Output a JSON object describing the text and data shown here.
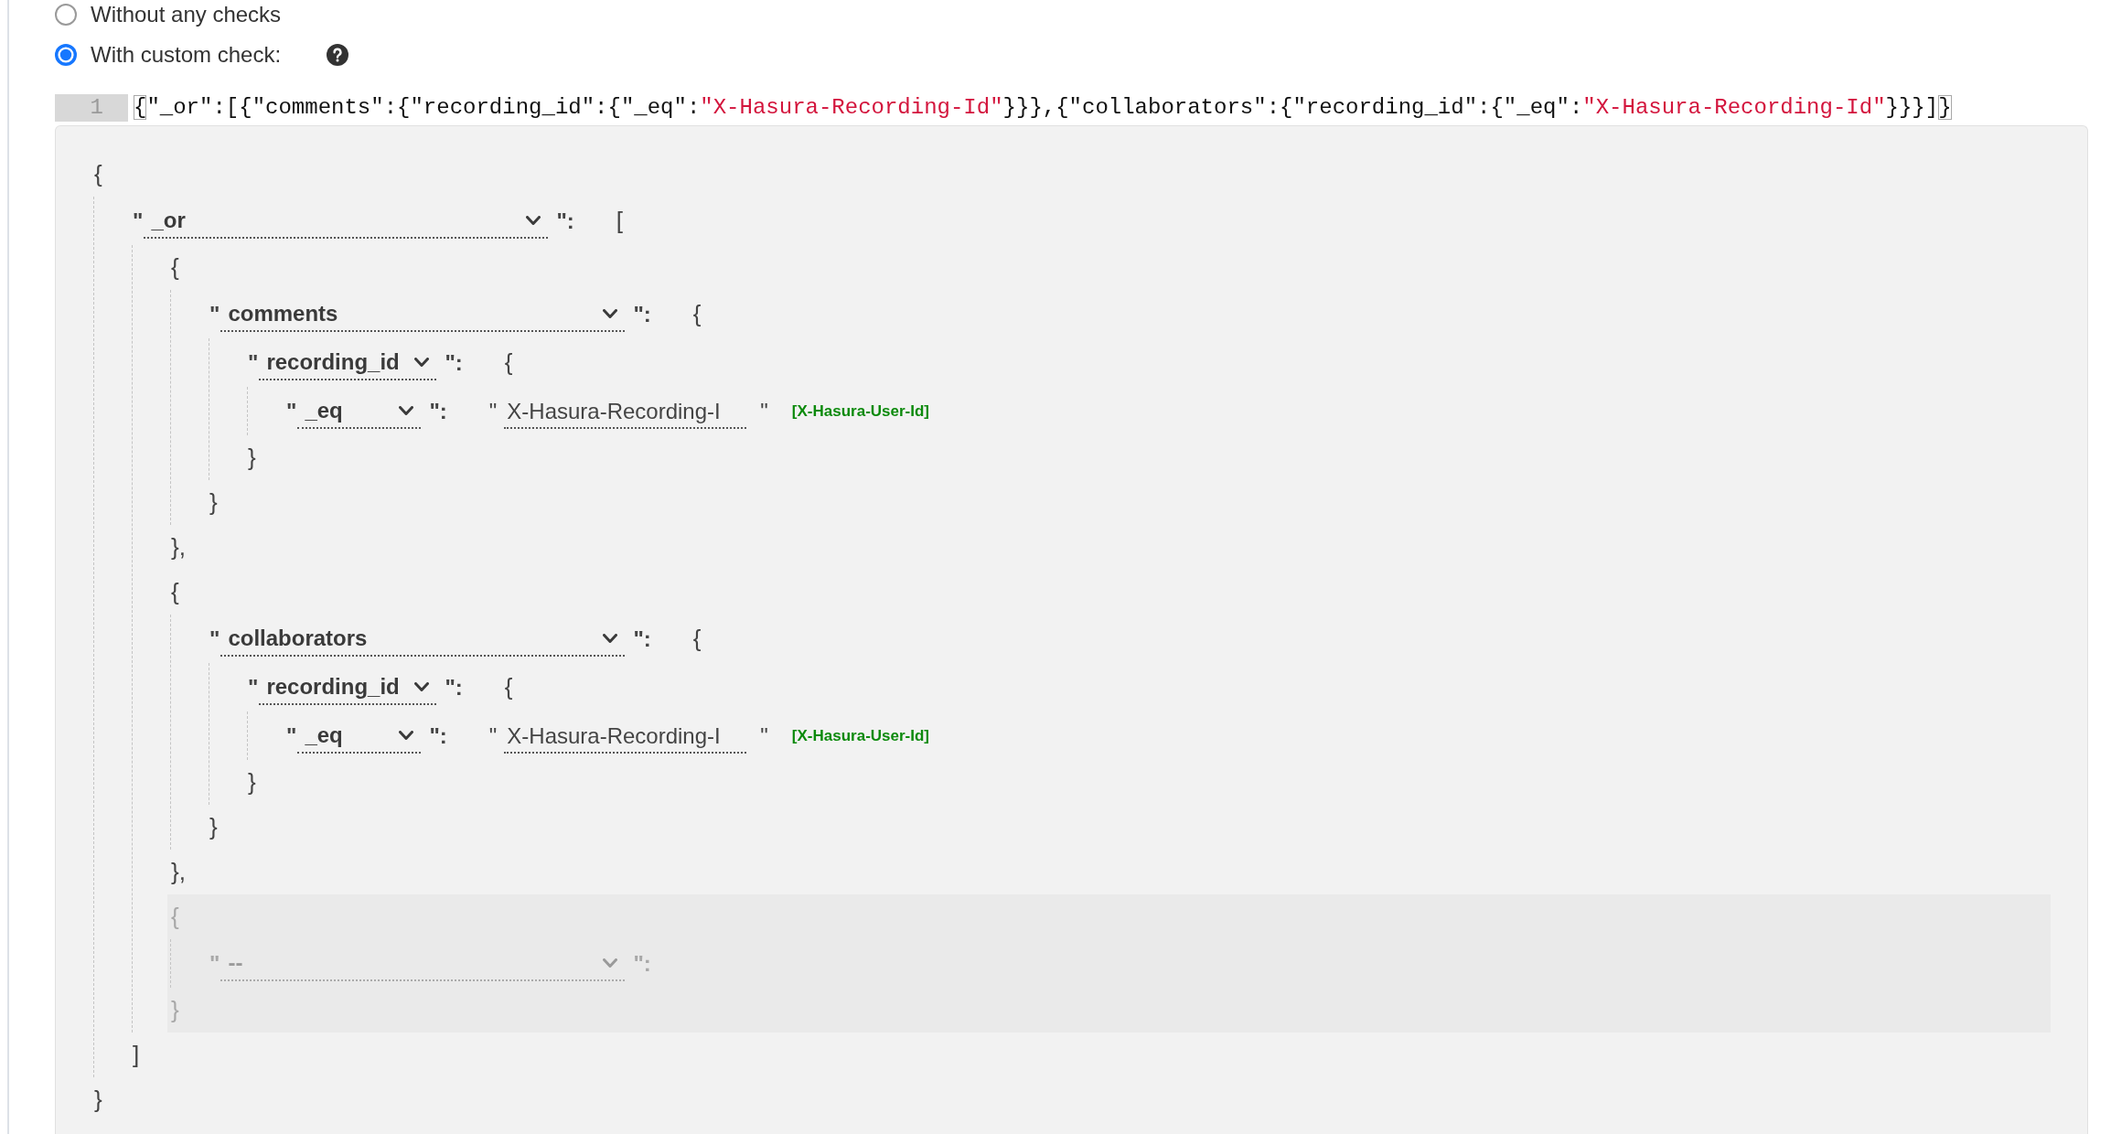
{
  "access_options": [
    {
      "label": "Without any checks",
      "selected": false,
      "has_help": false
    },
    {
      "label": "With custom check:",
      "selected": true,
      "has_help": true
    }
  ],
  "editor": {
    "lines": [
      {
        "number": "1",
        "tokens": [
          {
            "text": "{",
            "kind": "matched"
          },
          {
            "text": "\"_or\":[{\"comments\":{\"recording_id\":{\"_eq\":",
            "kind": "plain"
          },
          {
            "text": "\"X-Hasura-Recording-Id\"",
            "kind": "string"
          },
          {
            "text": "}}},{\"collaborators\":{\"recording_id\":{\"_eq\":",
            "kind": "plain"
          },
          {
            "text": "\"X-Hasura-Recording-Id\"",
            "kind": "string"
          },
          {
            "text": "}}}]",
            "kind": "plain"
          },
          {
            "text": "}",
            "kind": "matched"
          }
        ]
      }
    ]
  },
  "builder": {
    "root": {
      "kind": "object",
      "open": "{",
      "close": "}",
      "entries": [
        {
          "quote": "\"",
          "key": "_or",
          "colon": "\":",
          "value": {
            "kind": "array",
            "open": "[",
            "close": "]",
            "items": [
              {
                "kind": "object",
                "open": "{",
                "close": "},",
                "pending": false,
                "entries": [
                  {
                    "quote": "\"",
                    "key": "comments",
                    "colon": "\":",
                    "value": {
                      "kind": "object",
                      "open": "{",
                      "close": "}",
                      "entries": [
                        {
                          "quote": "\"",
                          "key": "recording_id",
                          "colon": "\":",
                          "value": {
                            "kind": "object",
                            "open": "{",
                            "close": "}",
                            "entries": [
                              {
                                "quote": "\"",
                                "key": "_eq",
                                "colon": "\":",
                                "value": {
                                  "kind": "string",
                                  "open": "\"",
                                  "text": "X-Hasura-Recording-I",
                                  "close": "\"",
                                  "session_variable": "[X-Hasura-User-Id]"
                                }
                              }
                            ]
                          }
                        }
                      ]
                    }
                  }
                ]
              },
              {
                "kind": "object",
                "open": "{",
                "close": "},",
                "pending": false,
                "entries": [
                  {
                    "quote": "\"",
                    "key": "collaborators",
                    "colon": "\":",
                    "value": {
                      "kind": "object",
                      "open": "{",
                      "close": "}",
                      "entries": [
                        {
                          "quote": "\"",
                          "key": "recording_id",
                          "colon": "\":",
                          "value": {
                            "kind": "object",
                            "open": "{",
                            "close": "}",
                            "entries": [
                              {
                                "quote": "\"",
                                "key": "_eq",
                                "colon": "\":",
                                "value": {
                                  "kind": "string",
                                  "open": "\"",
                                  "text": "X-Hasura-Recording-I",
                                  "close": "\"",
                                  "session_variable": "[X-Hasura-User-Id]"
                                }
                              }
                            ]
                          }
                        }
                      ]
                    }
                  }
                ]
              },
              {
                "kind": "object",
                "open": "{",
                "close": "}",
                "pending": true,
                "entries": [
                  {
                    "quote": "\"",
                    "key": "--",
                    "colon": "\":"
                  }
                ]
              }
            ]
          }
        }
      ]
    }
  }
}
